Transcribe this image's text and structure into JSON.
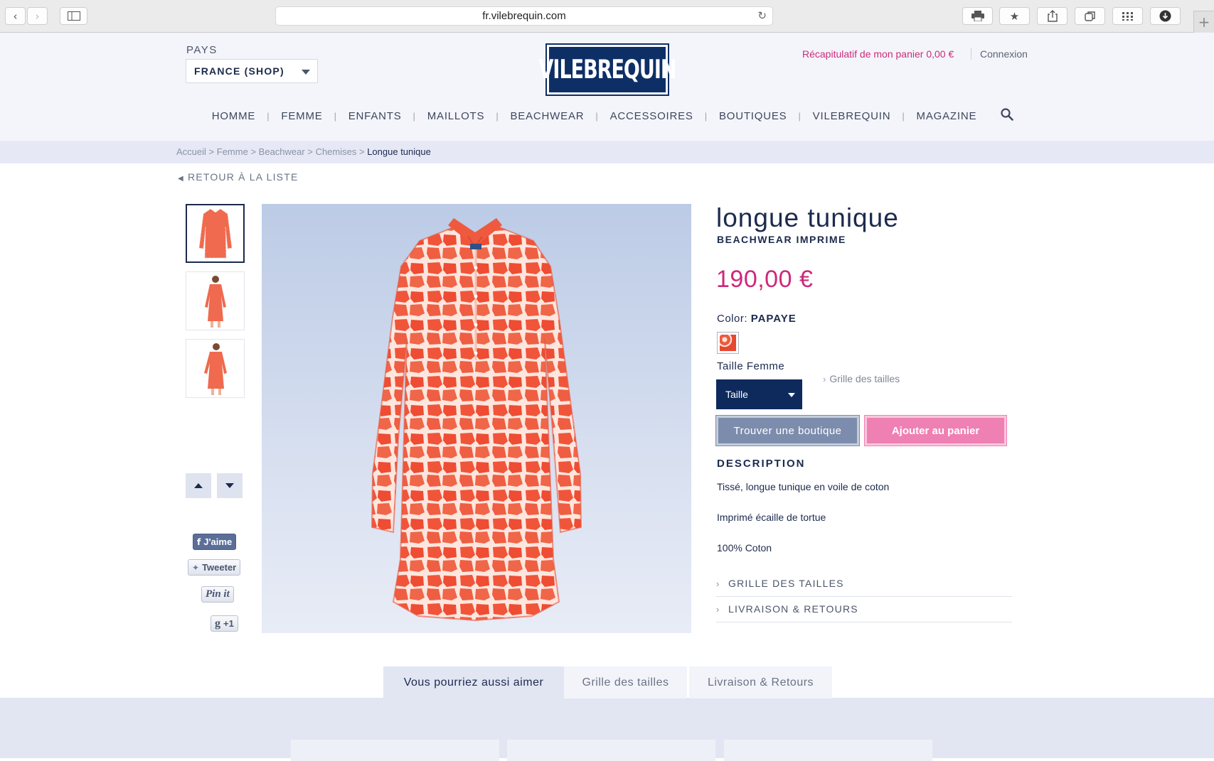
{
  "browser": {
    "url": "fr.vilebrequin.com"
  },
  "header": {
    "country_label": "PAYS",
    "country_value": "FRANCE (SHOP)",
    "logo_text": "VILEBREQUIN",
    "cart_summary": "Récapitulatif de mon panier 0,00 €",
    "login": "Connexion"
  },
  "nav": {
    "items": [
      "HOMME",
      "FEMME",
      "ENFANTS",
      "MAILLOTS",
      "BEACHWEAR",
      "ACCESSOIRES",
      "BOUTIQUES",
      "VILEBREQUIN",
      "MAGAZINE"
    ]
  },
  "breadcrumb": {
    "items": [
      "Accueil",
      "Femme",
      "Beachwear",
      "Chemises"
    ],
    "current": "Longue tunique",
    "separator": ">"
  },
  "back_link": "RETOUR À LA LISTE",
  "social": {
    "facebook": "J'aime",
    "twitter": "Tweeter",
    "pinterest": "Pin it",
    "google": "+1"
  },
  "product": {
    "title": "longue tunique",
    "subtitle": "BEACHWEAR IMPRIME",
    "price": "190,00 €",
    "color_label": "Color:",
    "color_value": "PAPAYE",
    "size_label": "Taille Femme",
    "size_select": "Taille",
    "size_grid_link": "Grille des tailles",
    "find_store_button": "Trouver une boutique",
    "add_to_cart_button": "Ajouter au panier",
    "description_heading": "DESCRIPTION",
    "description_lines": [
      "Tissé, longue tunique en voile de coton",
      "Imprimé écaille de tortue",
      "100% Coton"
    ],
    "accordions": [
      "GRILLE DES TAILLES",
      "LIVRAISON & RETOURS"
    ]
  },
  "bottom_tabs": [
    "Vous pourriez aussi aimer",
    "Grille des tailles",
    "Livraison & Retours"
  ],
  "colors": {
    "accent_pink": "#cc2a7a",
    "navy": "#1c2a4d",
    "papaye": "#ef5a3c"
  }
}
